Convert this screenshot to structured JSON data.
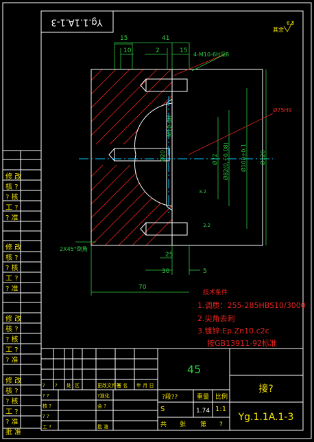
{
  "drawing_number": "Yg.1.1A.1-3",
  "drawing_number_rotated": "Yg.1.1A.1-3",
  "roughness_note": "其余",
  "roughness_value": "6.3",
  "dimensions": {
    "d15_top": "15",
    "d41": "41",
    "d10": "10",
    "d2": "2",
    "d15_right": "15",
    "thread_callout": "4-M10-6H深8",
    "bore_dia": "Ø75H9",
    "m10": "M10-6H",
    "dia_inner": "Ø20",
    "dia72": "Ø72",
    "dia82": "Ø82(0,+0.08)",
    "dia100": "Ø100±0.1",
    "dia120": "Ø120",
    "r3_2_a": "3.2",
    "r3_2_b": "3.2",
    "chamfer": "2X45°倒角",
    "d25": "25",
    "d30": "30",
    "d5": "5",
    "d70": "70"
  },
  "tech_requirements": {
    "title": "技术条件",
    "items": [
      "1.调质：255-285HBS10/3000",
      "2.尖角去刺",
      "3.镀锌:Ep.Zn10.c2c",
      "按GB13911-92标准"
    ]
  },
  "side_labels": [
    [
      "修 改",
      "核 ?",
      "? 核",
      "工 ?",
      "? 准"
    ],
    [
      "修 改",
      "核 ?",
      "? 核",
      "工 ?",
      "? 准"
    ],
    [
      "修 改",
      "核 ?",
      "? 核",
      "工 ?",
      "? 准"
    ],
    [
      "修 改",
      "核 ?",
      "? 核",
      "工 ?",
      "? 准",
      "批 准"
    ]
  ],
  "title_block": {
    "material": "45",
    "part_name": "接?",
    "rev_headers": [
      "?",
      "?",
      "处",
      "区",
      "更改文件号",
      "签 名",
      "年 月 日"
    ],
    "row_labels": [
      "? ?",
      "核 ?",
      "? ?",
      "工 ?"
    ],
    "std_label": "?准化",
    "approve": "会 ?",
    "approve2": "批 准",
    "stage_label": "?段??",
    "weight_label": "重量",
    "scale_label": "比例",
    "stage_value": "S",
    "weight_value": "1.74",
    "scale_value": "1:1",
    "total_label": "共",
    "sheets_label": "张",
    "sheet_label": "第",
    "sheet_no_label": "?",
    "drawing_number": "Yg.1.1A.1-3"
  }
}
